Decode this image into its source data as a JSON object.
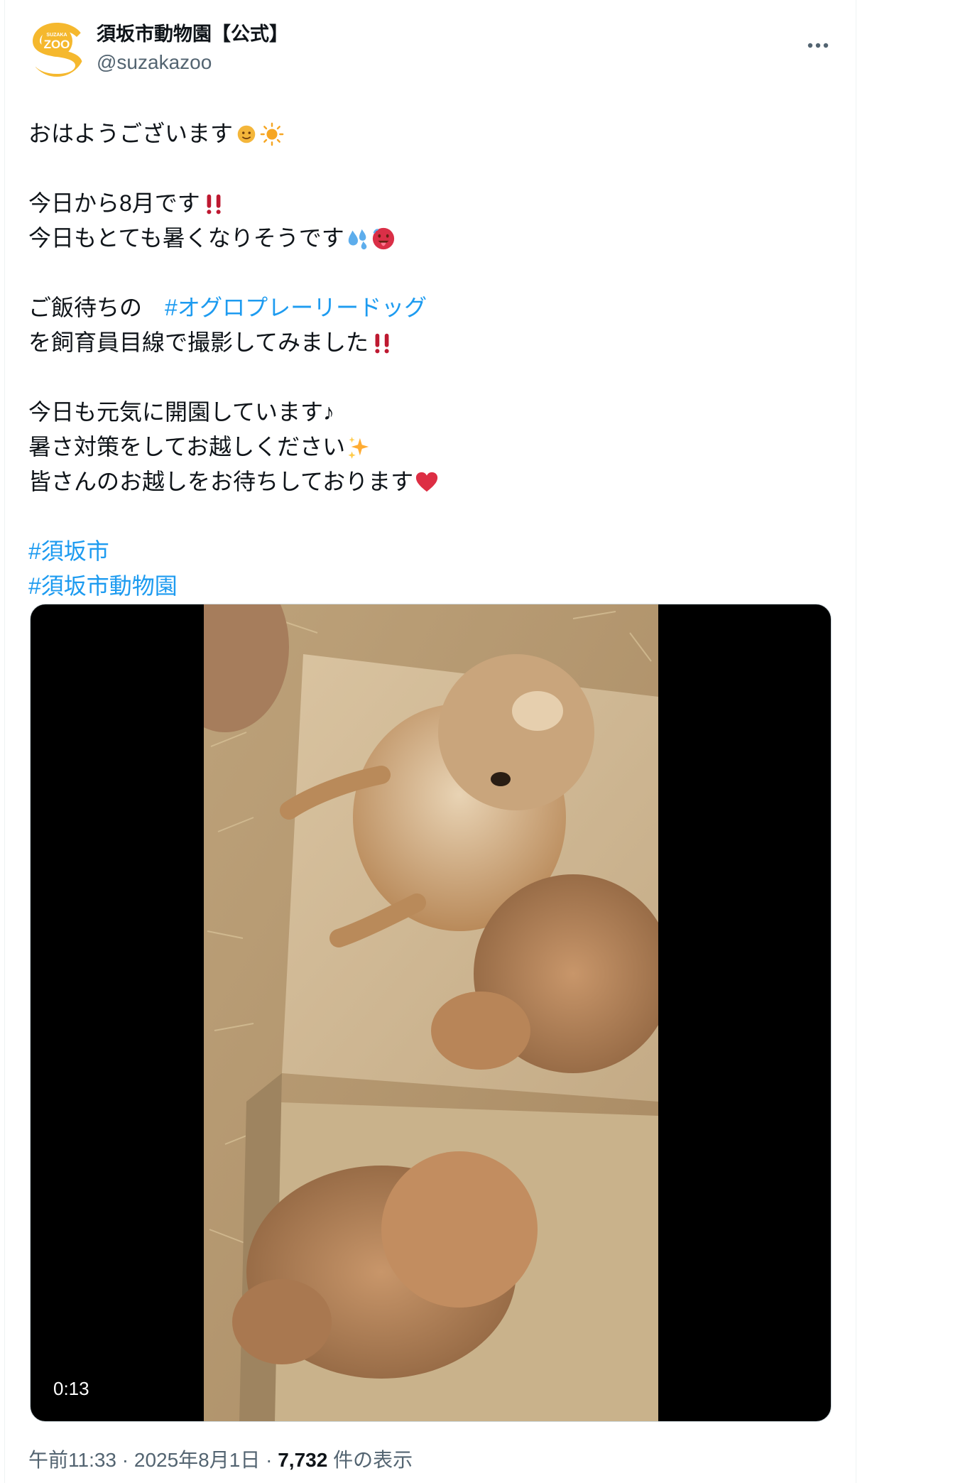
{
  "account": {
    "display_name": "須坂市動物園【公式】",
    "handle": "@suzakazoo",
    "avatar_text_top": "SUZAKA",
    "avatar_text_main": "ZOO",
    "avatar_color": "#f5b82e"
  },
  "more_icon": "more-horizontal-icon",
  "tweet": {
    "line1": "おはようございます",
    "line2": "今日から8月です",
    "line3": "今日もとても暑くなりそうです",
    "line4_prefix": "ご飯待ちの　",
    "line4_hashtag": "#オグロプレーリードッグ",
    "line5": "を飼育員目線で撮影してみました",
    "line6": "今日も元気に開園しています♪",
    "line7": "暑さ対策をしてお越しください",
    "line8": "皆さんのお越しをお待ちしております",
    "hashtag1": "#須坂市",
    "hashtag2": "#須坂市動物園"
  },
  "media": {
    "duration": "0:13",
    "type": "video"
  },
  "meta": {
    "time": "午前11:33",
    "sep1": " · ",
    "date": "2025年8月1日",
    "sep2": " · ",
    "views": "7,732",
    "views_label": " 件の表示"
  },
  "colors": {
    "link": "#1d9bf0",
    "secondary_text": "#536471",
    "border": "#cfd9de"
  }
}
